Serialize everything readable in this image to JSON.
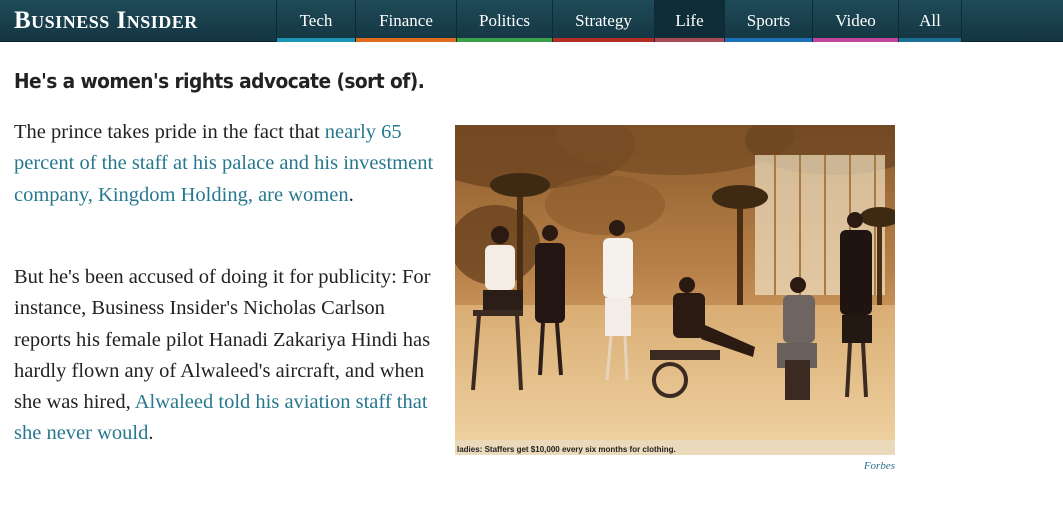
{
  "header": {
    "logo_text": "Business Insider",
    "nav": [
      {
        "label": "Tech",
        "color": "#1a93b4"
      },
      {
        "label": "Finance",
        "color": "#e06b1f"
      },
      {
        "label": "Politics",
        "color": "#3aa04b"
      },
      {
        "label": "Strategy",
        "color": "#b32d22"
      },
      {
        "label": "Life",
        "color": "#a84a58",
        "active": true
      },
      {
        "label": "Sports",
        "color": "#1d6fb8"
      },
      {
        "label": "Video",
        "color": "#c0449c"
      },
      {
        "label": "All",
        "color": "#1b6f94"
      }
    ]
  },
  "article": {
    "heading": "He's a women's rights advocate (sort of).",
    "para1": {
      "t1": "The prince takes pride in the fact that ",
      "link": "nearly 65 percent of the staff at his palace and his investment company, Kingdom Holding, are women",
      "t2": "."
    },
    "para2": {
      "t1": "But he's been accused of doing it for publicity: For instance, Business Insider's Nicholas Carlson reports his female pilot Hanadi Zakariya Hindi has hardly flown any of Alwaleed's aircraft, and when she was hired, ",
      "link": "Alwaleed told his aviation staff that she never would",
      "t2": "."
    },
    "image": {
      "caption_in_image": "ladies: Staffers get $10,000 every six months for clothing.",
      "credit": "Forbes"
    }
  }
}
